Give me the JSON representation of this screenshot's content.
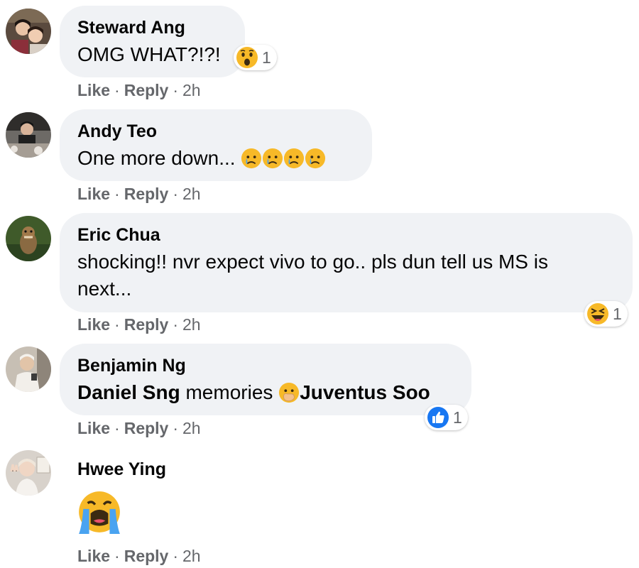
{
  "comments": [
    {
      "author": "Steward Ang",
      "text": "OMG WHAT?!?!",
      "reaction": {
        "icon": "wow-emoji-icon",
        "count": "1"
      },
      "actions": {
        "like": "Like",
        "reply": "Reply",
        "time": "2h"
      }
    },
    {
      "author": "Andy Teo",
      "text": "One more down...",
      "emojis": [
        "crying-face-icon",
        "crying-face-icon",
        "crying-face-icon",
        "crying-face-icon"
      ],
      "actions": {
        "like": "Like",
        "reply": "Reply",
        "time": "2h"
      }
    },
    {
      "author": "Eric Chua",
      "text": "shocking!! nvr expect vivo to go.. pls dun tell us MS is next...",
      "reaction": {
        "icon": "haha-emoji-icon",
        "count": "1"
      },
      "actions": {
        "like": "Like",
        "reply": "Reply",
        "time": "2h"
      }
    },
    {
      "author": "Benjamin Ng",
      "mention1": "Daniel Sng",
      "text": "memories",
      "mention2": "Juventus Soo",
      "reaction": {
        "icon": "like-reaction-icon",
        "count": "1"
      },
      "actions": {
        "like": "Like",
        "reply": "Reply",
        "time": "2h"
      }
    },
    {
      "author": "Hwee Ying",
      "emoji": "loudly-crying-face-icon",
      "actions": {
        "like": "Like",
        "reply": "Reply",
        "time": "2h"
      }
    }
  ],
  "colors": {
    "bubble": "#f0f2f5",
    "meta": "#65676b",
    "text": "#050505",
    "like_blue": "#1877f2"
  }
}
